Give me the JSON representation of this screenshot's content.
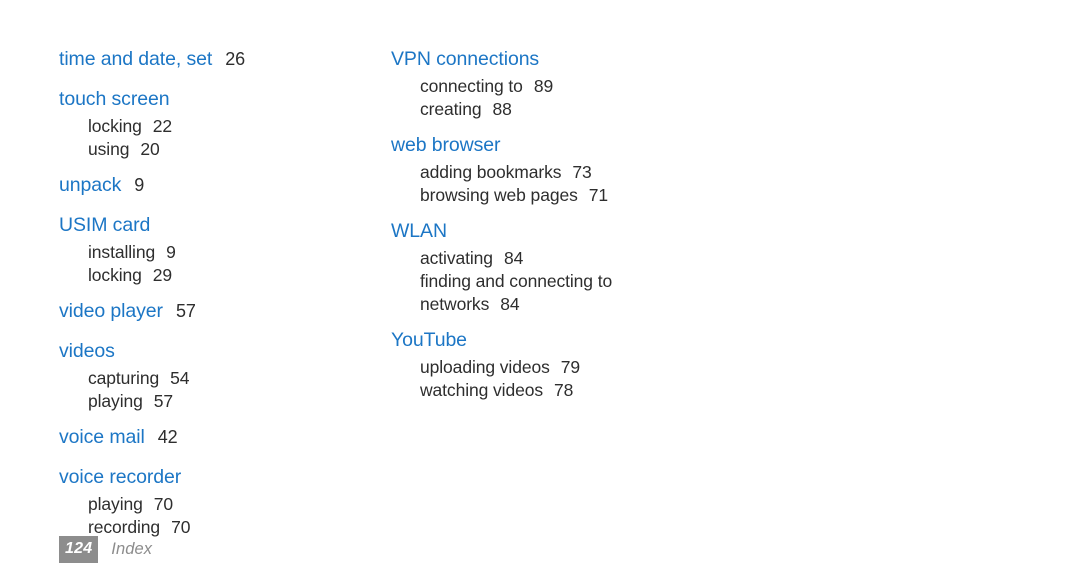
{
  "document": {
    "type": "index-page",
    "background_color": "#ffffff",
    "heading_color": "#1c76c5",
    "body_text_color": "#2e2e2e",
    "footer_color": "#8d8d8d"
  },
  "columns": [
    {
      "name": "left-column",
      "groups": [
        {
          "heading": "time and date, set",
          "page": "26",
          "subentries": []
        },
        {
          "heading": "touch screen",
          "page": "",
          "subentries": [
            {
              "label": "locking",
              "page": "22"
            },
            {
              "label": "using",
              "page": "20"
            }
          ]
        },
        {
          "heading": "unpack",
          "page": "9",
          "subentries": []
        },
        {
          "heading": "USIM card",
          "page": "",
          "subentries": [
            {
              "label": "installing",
              "page": "9"
            },
            {
              "label": "locking",
              "page": "29"
            }
          ]
        },
        {
          "heading": "video player",
          "page": "57",
          "subentries": []
        },
        {
          "heading": "videos",
          "page": "",
          "subentries": [
            {
              "label": "capturing",
              "page": "54"
            },
            {
              "label": "playing",
              "page": "57"
            }
          ]
        },
        {
          "heading": "voice mail",
          "page": "42",
          "subentries": []
        },
        {
          "heading": "voice recorder",
          "page": "",
          "subentries": [
            {
              "label": "playing",
              "page": "70"
            },
            {
              "label": "recording",
              "page": "70"
            }
          ]
        }
      ]
    },
    {
      "name": "right-column",
      "groups": [
        {
          "heading": "VPN connections",
          "page": "",
          "subentries": [
            {
              "label": "connecting to",
              "page": "89"
            },
            {
              "label": "creating",
              "page": "88"
            }
          ]
        },
        {
          "heading": "web browser",
          "page": "",
          "subentries": [
            {
              "label": "adding bookmarks",
              "page": "73"
            },
            {
              "label": "browsing web pages",
              "page": "71"
            }
          ]
        },
        {
          "heading": "WLAN",
          "page": "",
          "subentries": [
            {
              "label": "activating",
              "page": "84"
            },
            {
              "label": "finding and connecting to",
              "page": ""
            },
            {
              "label": "networks",
              "page": "84"
            }
          ]
        },
        {
          "heading": "YouTube",
          "page": "",
          "subentries": [
            {
              "label": "uploading videos",
              "page": "79"
            },
            {
              "label": "watching videos",
              "page": "78"
            }
          ]
        }
      ]
    }
  ],
  "footer": {
    "page_number": "124",
    "section_label": "Index"
  }
}
